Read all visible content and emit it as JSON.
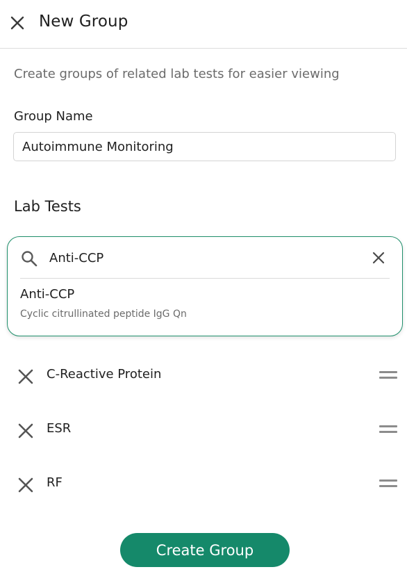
{
  "header": {
    "title": "New Group",
    "close_icon": "close-icon"
  },
  "form": {
    "subtitle": "Create groups of related lab tests for easier viewing",
    "group_name_label": "Group Name",
    "group_name_value": "Autoimmune Monitoring"
  },
  "lab_tests": {
    "title": "Lab Tests",
    "search": {
      "value": "Anti-CCP",
      "search_icon": "search-icon",
      "clear_icon": "close-icon",
      "results": [
        {
          "name": "Anti-CCP",
          "description": "Cyclic citrullinated peptide IgG Qn"
        }
      ]
    },
    "selected": [
      {
        "name": "C-Reactive Protein"
      },
      {
        "name": "ESR"
      },
      {
        "name": "RF"
      }
    ],
    "remove_icon": "close-icon",
    "drag_icon": "drag-handle-icon"
  },
  "actions": {
    "create_label": "Create Group"
  },
  "colors": {
    "accent": "#15896a",
    "focus_border": "#1f8f6b",
    "muted_text": "#6b6b6b",
    "text": "#1f1f1f"
  }
}
